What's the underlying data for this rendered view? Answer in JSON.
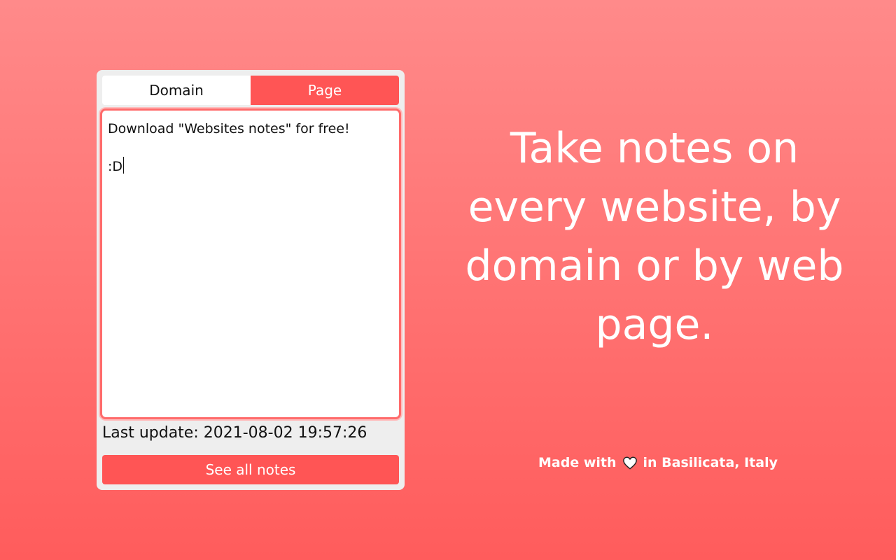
{
  "popup": {
    "tabs": [
      {
        "label": "Domain",
        "active": false
      },
      {
        "label": "Page",
        "active": true
      }
    ],
    "editor": {
      "line1": "Download \"Websites notes\" for free!",
      "line2": ":D"
    },
    "last_update": "Last update: 2021-08-02 19:57:26",
    "see_all_label": "See all notes"
  },
  "headline": "Take notes on every website, by domain or by web page.",
  "footer": {
    "made_with": "Made with",
    "icon": "heart-icon",
    "location": "in Basilicata, Italy"
  },
  "colors": {
    "accent": "#ff5555",
    "background_top": "#ff8a8a",
    "background_bottom": "#ff5c5c"
  }
}
